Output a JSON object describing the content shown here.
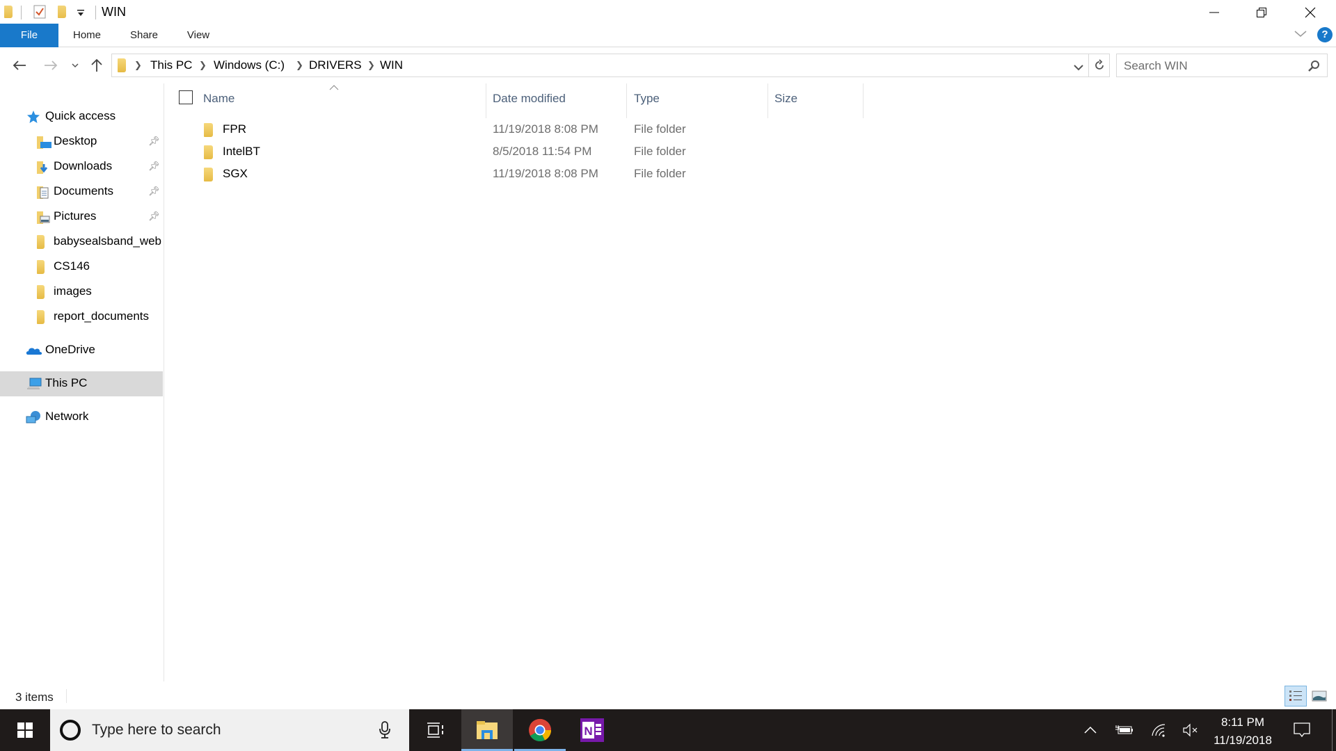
{
  "window": {
    "title": "WIN",
    "controls": {
      "minimize": "minimize",
      "restore": "restore",
      "close": "close"
    }
  },
  "ribbon": {
    "tabs": [
      {
        "label": "File",
        "active": true
      },
      {
        "label": "Home"
      },
      {
        "label": "Share"
      },
      {
        "label": "View"
      }
    ],
    "help": "?"
  },
  "address": {
    "breadcrumb": [
      "This PC",
      "Windows (C:)",
      "DRIVERS",
      "WIN"
    ],
    "search_placeholder": "Search WIN"
  },
  "sidebar": {
    "quick_access": "Quick access",
    "pinned": [
      {
        "label": "Desktop",
        "icon": "desktop-folder-icon",
        "pinned": true
      },
      {
        "label": "Downloads",
        "icon": "downloads-folder-icon",
        "pinned": true
      },
      {
        "label": "Documents",
        "icon": "documents-folder-icon",
        "pinned": true
      },
      {
        "label": "Pictures",
        "icon": "pictures-folder-icon",
        "pinned": true
      },
      {
        "label": "babysealsband_web",
        "icon": "folder-icon"
      },
      {
        "label": "CS146",
        "icon": "folder-icon"
      },
      {
        "label": "images",
        "icon": "folder-icon"
      },
      {
        "label": "report_documents",
        "icon": "folder-icon"
      }
    ],
    "onedrive": "OneDrive",
    "this_pc": "This PC",
    "network": "Network",
    "selected": "This PC"
  },
  "table": {
    "columns": [
      "Name",
      "Date modified",
      "Type",
      "Size"
    ],
    "sort_column": "Name",
    "rows": [
      {
        "name": "FPR",
        "date": "11/19/2018 8:08 PM",
        "type": "File folder",
        "size": ""
      },
      {
        "name": "IntelBT",
        "date": "8/5/2018 11:54 PM",
        "type": "File folder",
        "size": ""
      },
      {
        "name": "SGX",
        "date": "11/19/2018 8:08 PM",
        "type": "File folder",
        "size": ""
      }
    ]
  },
  "status": {
    "count": "3 items",
    "view": "details"
  },
  "taskbar": {
    "search_placeholder": "Type here to search",
    "apps": [
      "task-view",
      "file-explorer",
      "chrome",
      "onenote"
    ],
    "active_app": "file-explorer",
    "time": "8:11 PM",
    "date": "11/19/2018"
  },
  "colors": {
    "accent": "#1979ca",
    "taskbar": "#1f1b1a",
    "selected_nav": "#d9d9d9",
    "header_text": "#4c607a"
  }
}
